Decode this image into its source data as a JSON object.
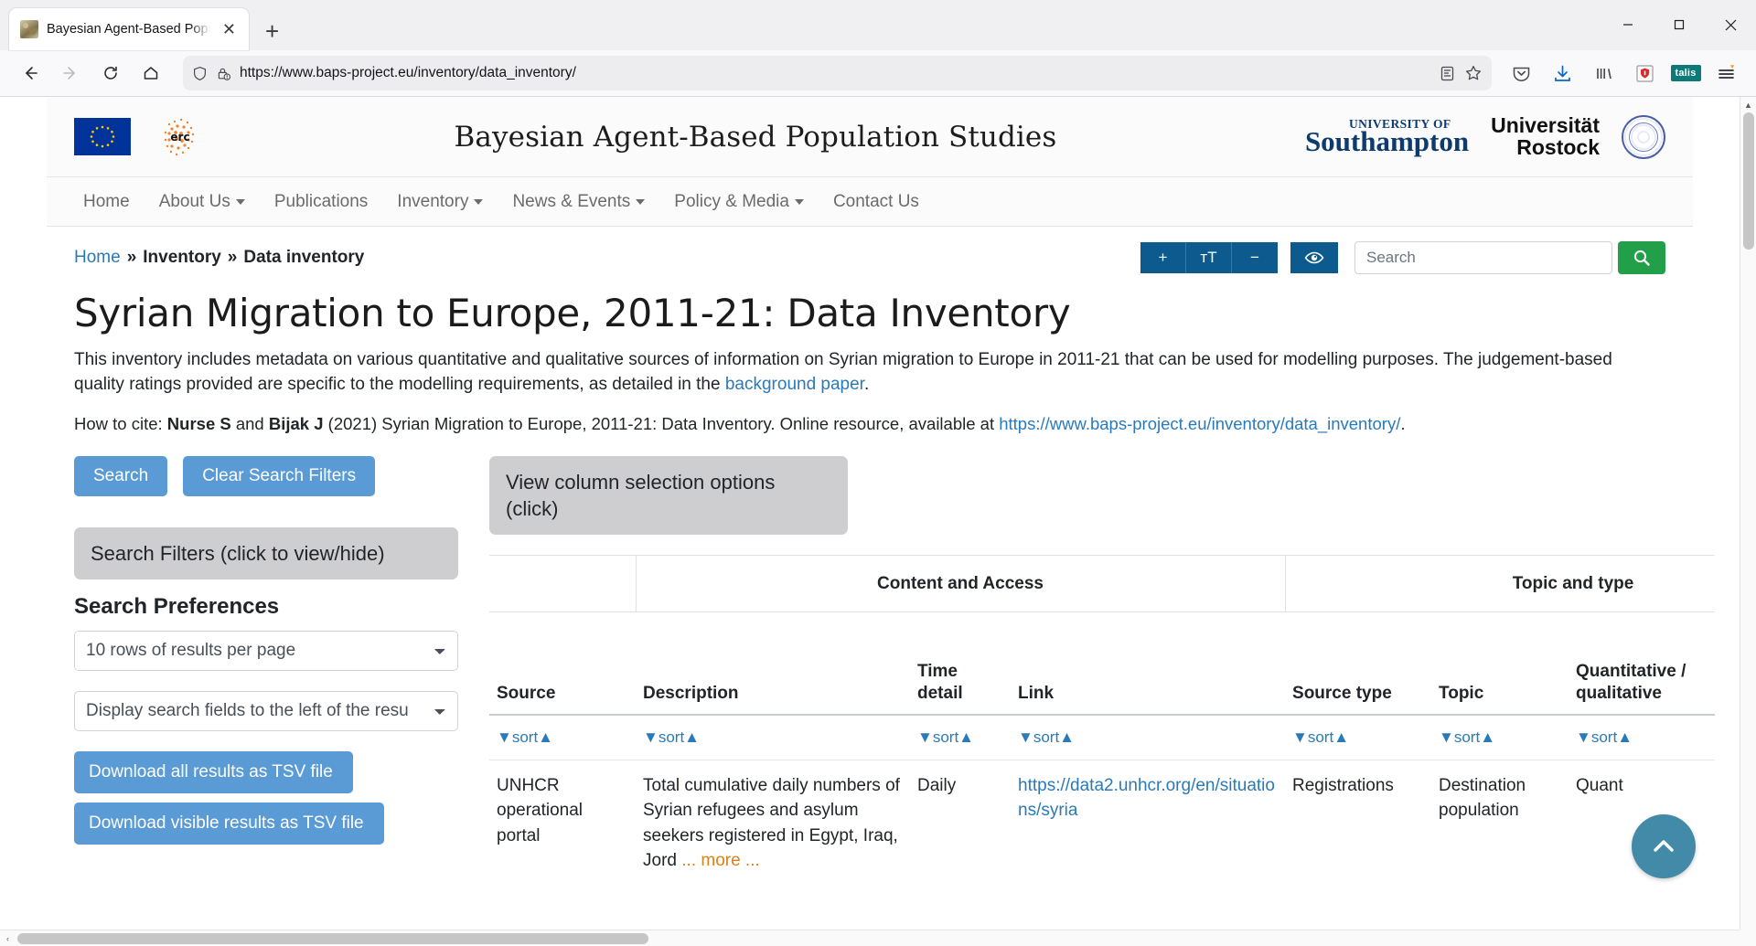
{
  "browser": {
    "tab": {
      "title": "Bayesian Agent-Based Population",
      "favicon": "site-favicon",
      "close": "✕"
    },
    "new_tab": "+",
    "window_controls": {
      "minimize": "—",
      "maximize": "❐",
      "close": "✕"
    },
    "nav": {
      "back": "←",
      "forward": "→",
      "reload": "⟳",
      "home": "⌂"
    },
    "url": "https://www.baps-project.eu/inventory/data_inventory/",
    "url_icons": {
      "shield": "tracking-protection-icon",
      "lock": "insecure-lock-icon",
      "reader": "reader-view-icon",
      "bookmark": "bookmark-star-icon"
    },
    "toolbar_icons": [
      {
        "name": "pocket-icon",
        "label": ""
      },
      {
        "name": "downloads-icon",
        "label": ""
      },
      {
        "name": "library-icon",
        "label": ""
      },
      {
        "name": "shield-extension-icon",
        "label": ""
      },
      {
        "name": "talis-extension-icon",
        "label": "talis"
      },
      {
        "name": "app-menu-icon",
        "label": ""
      }
    ]
  },
  "site": {
    "logos": {
      "eu": "european-union-flag",
      "erc": "erc",
      "southampton_small": "UNIVERSITY OF",
      "southampton_big": "Southampton",
      "rostock_1": "Universität",
      "rostock_2": "Rostock"
    },
    "title": "Bayesian Agent-Based Population Studies",
    "nav": [
      {
        "label": "Home",
        "dropdown": false
      },
      {
        "label": "About Us",
        "dropdown": true
      },
      {
        "label": "Publications",
        "dropdown": false
      },
      {
        "label": "Inventory",
        "dropdown": true
      },
      {
        "label": "News & Events",
        "dropdown": true
      },
      {
        "label": "Policy & Media",
        "dropdown": true
      },
      {
        "label": "Contact Us",
        "dropdown": false
      }
    ]
  },
  "breadcrumb": {
    "home": "Home",
    "sep": "»",
    "inventory": "Inventory",
    "current": "Data inventory"
  },
  "a11y": {
    "increase": "+",
    "text_size": "ᴛT",
    "decrease": "−",
    "contrast": "contrast-eye-icon"
  },
  "search": {
    "placeholder": "Search",
    "value": "",
    "button": "search-icon"
  },
  "main": {
    "page_title": "Syrian Migration to Europe, 2011-21: Data Inventory",
    "intro_part1": "This inventory includes metadata on various quantitative and qualitative sources of information on Syrian migration to Europe in 2011-21 that can be used for modelling purposes. The judgement-based quality ratings provided are specific to the modelling requirements, as detailed in the ",
    "intro_link": "background paper",
    "intro_part2": ".",
    "cite_label": "How to cite: ",
    "cite_author1": "Nurse S",
    "cite_and": " and ",
    "cite_author2": "Bijak J",
    "cite_rest": " (2021) Syrian Migration to Europe, 2011-21: Data Inventory. Online resource, available at ",
    "cite_link": "https://www.baps-project.eu/inventory/data_inventory/",
    "cite_end": ".",
    "search_button": "Search",
    "clear_button": "Clear Search Filters",
    "column_options_panel": "View column selection options (click)"
  },
  "sidebar": {
    "filters_panel": "Search Filters (click to view/hide)",
    "preferences_title": "Search Preferences",
    "rows_per_page": "10 rows of results per page",
    "field_layout": "Display search fields to the left of the resu",
    "download_all": "Download all results as TSV file",
    "download_visible": "Download visible results as TSV file"
  },
  "table": {
    "group_headers": [
      {
        "label": "",
        "span": 1
      },
      {
        "label": "Content and Access",
        "span": 3
      },
      {
        "label": "",
        "span": 1
      },
      {
        "label": "Topic and type",
        "span": 2
      }
    ],
    "columns": [
      "Source",
      "Description",
      "Time detail",
      "Link",
      "Source type",
      "Topic",
      "Quantitative / qualitative"
    ],
    "sort_label": "sort",
    "sort_desc_glyph": "▼",
    "sort_asc_glyph": "▲",
    "rows": [
      {
        "source": "UNHCR operational portal",
        "description": "Total cumulative daily numbers of Syrian refugees and asylum seekers registered in Egypt, Iraq, Jord",
        "more": "... more ...",
        "time_detail": "Daily",
        "link": "https://data2.unhcr.org/en/situations/syria",
        "source_type": "Registrations",
        "topic": "Destination population",
        "quant_qual": "Quant"
      }
    ]
  },
  "to_top": {
    "glyph": "⌃"
  },
  "scrollbars": {
    "up": "▲",
    "down": "▼",
    "left": "‹",
    "right": "›"
  },
  "colors": {
    "accent_blue": "#5a9bd5",
    "link_blue": "#2a7ab9",
    "dark_blue": "#0d5b8e",
    "green": "#22a049",
    "gray_panel": "#ceced0",
    "orange": "#d98218",
    "teal": "#4389a8"
  }
}
